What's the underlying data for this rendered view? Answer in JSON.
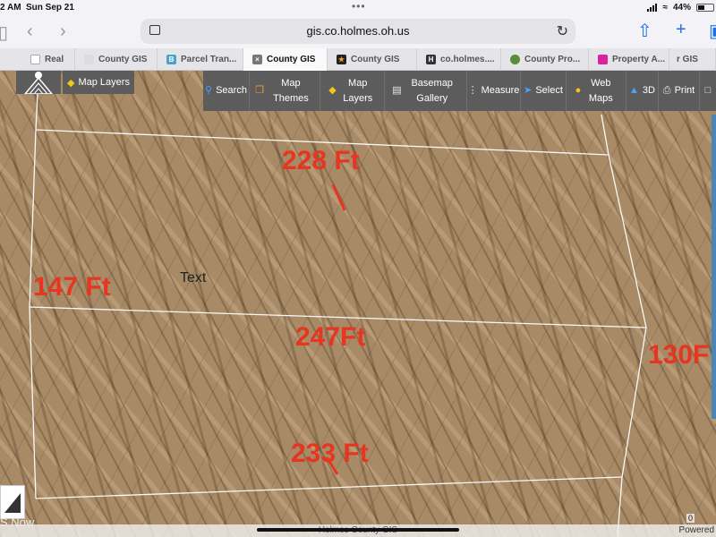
{
  "status_bar": {
    "time": "2 AM",
    "date": "Sun Sep 21",
    "battery": "44%"
  },
  "browser": {
    "url": "gis.co.holmes.oh.us",
    "tabs": [
      {
        "label": "Real",
        "icon": "shield-icon",
        "color": "#999999"
      },
      {
        "label": "County GIS",
        "icon": "globe-icon",
        "color": "#999999"
      },
      {
        "label": "Parcel Tran...",
        "icon": "bc-icon",
        "color": "#4aa3cf"
      },
      {
        "label": "County GIS",
        "icon": "close-icon",
        "color": "#777777",
        "active": true
      },
      {
        "label": "County GIS",
        "icon": "star-icon",
        "color": "#222222"
      },
      {
        "label": "co.holmes....",
        "icon": "h-icon",
        "color": "#333333"
      },
      {
        "label": "County Pro...",
        "icon": "seal-icon",
        "color": "#5a8c3a"
      },
      {
        "label": "Property A...",
        "icon": "instagram-icon",
        "color": "#d6249f"
      },
      {
        "label": "r GIS",
        "icon": "",
        "color": "#999999"
      }
    ]
  },
  "gis": {
    "map_layers_top": "Map Layers",
    "tools": [
      {
        "id": "search",
        "label": "Search",
        "icon": "search-icon"
      },
      {
        "id": "map-themes",
        "label": "Map Themes",
        "icon": "copy-icon"
      },
      {
        "id": "map-layers",
        "label": "Map Layers",
        "icon": "layers-icon"
      },
      {
        "id": "basemap-gallery",
        "label": "Basemap Gallery",
        "icon": "basemap-icon"
      },
      {
        "id": "measure",
        "label": "Measure",
        "icon": "ruler-icon"
      },
      {
        "id": "select",
        "label": "Select",
        "icon": "cursor-icon"
      },
      {
        "id": "web-maps",
        "label": "Web Maps",
        "icon": "person-icon"
      },
      {
        "id": "3d",
        "label": "3D",
        "icon": "3d-icon"
      },
      {
        "id": "print",
        "label": "Print",
        "icon": "printer-icon"
      },
      {
        "id": "lock",
        "label": "",
        "icon": "lock-icon"
      }
    ]
  },
  "map": {
    "labels": {
      "top": "228 Ft",
      "left": "147 Ft",
      "middle": "247Ft",
      "right": "130F",
      "bottom": "233 Ft",
      "text_note": "Text"
    },
    "label_color": "#e8351f"
  },
  "footer": {
    "attribution": "Holmes County GIS",
    "powered": "Powered",
    "scale": "0",
    "left_text": "S Now"
  }
}
